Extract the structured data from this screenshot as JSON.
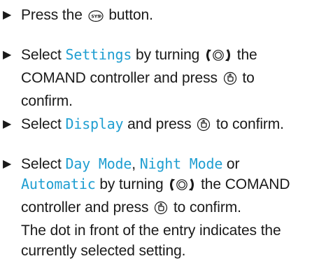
{
  "bullet_glyph": "▶",
  "steps": [
    {
      "p1": "Press the",
      "icon1": "sys-button-icon",
      "p2": "button."
    },
    {
      "p1": "Select",
      "menu1": "Settings",
      "p2": "by turning",
      "icon1": "turn-controller-icon",
      "p3": "the",
      "p4": "COMAND controller and press",
      "icon2": "press-confirm-icon",
      "p5": "to",
      "p6": "confirm."
    },
    {
      "p1": "Select",
      "menu1": "Display",
      "p2": "and press",
      "icon1": "press-confirm-icon",
      "p3": "to confirm."
    },
    {
      "p1": "Select",
      "menu1": "Day Mode",
      "p2": ",",
      "menu2": "Night Mode",
      "p3": "or",
      "menu3": "Automatic",
      "p4": "by turning",
      "icon1": "turn-controller-icon",
      "p5": "the COMAND",
      "p6": "controller and press",
      "icon2": "press-confirm-icon",
      "p7": "to confirm.",
      "p8": "The dot in front of the entry indicates the",
      "p9": "currently selected setting."
    }
  ],
  "colors": {
    "menu_text": "#1f9ed1",
    "body_text": "#1a1a1a"
  }
}
